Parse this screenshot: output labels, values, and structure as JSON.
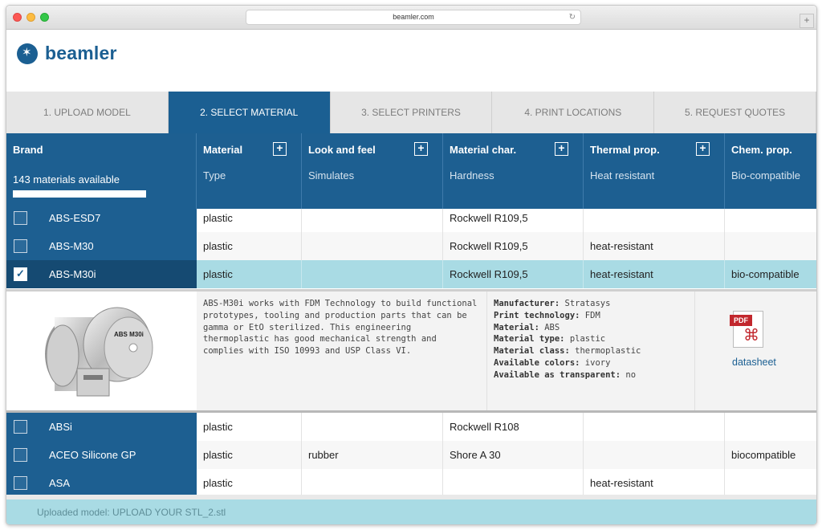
{
  "browser": {
    "url": "beamler.com"
  },
  "header": {
    "logo_text": "beamler"
  },
  "steps": [
    {
      "label": "1. UPLOAD MODEL"
    },
    {
      "label": "2. SELECT MATERIAL"
    },
    {
      "label": "3. SELECT PRINTERS"
    },
    {
      "label": "4. PRINT LOCATIONS"
    },
    {
      "label": "5. REQUEST QUOTES"
    }
  ],
  "columns": {
    "brand": {
      "title": "Brand",
      "count": "143 materials available"
    },
    "material": {
      "title": "Material",
      "sub": "Type"
    },
    "look": {
      "title": "Look and feel",
      "sub": "Simulates"
    },
    "char": {
      "title": "Material char.",
      "sub": "Hardness"
    },
    "thermal": {
      "title": "Thermal prop.",
      "sub": "Heat resistant"
    },
    "chem": {
      "title": "Chem. prop.",
      "sub": "Bio-compatible"
    }
  },
  "rows_top": [
    {
      "brand": "ABS-ESD7",
      "type": "plastic",
      "simulates": "",
      "hardness": "Rockwell R109,5",
      "heat": "",
      "bio": "",
      "checked": false
    },
    {
      "brand": "ABS-M30",
      "type": "plastic",
      "simulates": "",
      "hardness": "Rockwell R109,5",
      "heat": "heat-resistant",
      "bio": "",
      "checked": false
    },
    {
      "brand": "ABS-M30i",
      "type": "plastic",
      "simulates": "",
      "hardness": "Rockwell R109,5",
      "heat": "heat-resistant",
      "bio": "bio-compatible",
      "checked": true
    }
  ],
  "detail": {
    "description": "ABS-M30i works with FDM Technology to build functional prototypes, tooling and production parts that can be gamma or EtO sterilized. This engineering thermoplastic has good mechanical strength and complies with ISO 10993 and USP Class VI.",
    "specs": [
      {
        "label": "Manufacturer:",
        "value": "Stratasys"
      },
      {
        "label": "Print technology:",
        "value": "FDM"
      },
      {
        "label": "Material:",
        "value": "ABS"
      },
      {
        "label": "Material type:",
        "value": "plastic"
      },
      {
        "label": "Material class:",
        "value": "thermoplastic"
      },
      {
        "label": "Available colors:",
        "value": "ivory"
      },
      {
        "label": "Available as transparent:",
        "value": "no"
      }
    ],
    "pdf_tag": "PDF",
    "datasheet_label": "datasheet",
    "spool_label": "ABS M30i"
  },
  "rows_bottom": [
    {
      "brand": "ABSi",
      "type": "plastic",
      "simulates": "",
      "hardness": "Rockwell R108",
      "heat": "",
      "bio": "",
      "checked": false
    },
    {
      "brand": "ACEO Silicone GP",
      "type": "plastic",
      "simulates": "rubber",
      "hardness": "Shore A 30",
      "heat": "",
      "bio": "biocompatible",
      "checked": false
    },
    {
      "brand": "ASA",
      "type": "plastic",
      "simulates": "",
      "hardness": "",
      "heat": "heat-resistant",
      "bio": "",
      "checked": false
    }
  ],
  "footer": {
    "text": "Uploaded model: UPLOAD YOUR STL_2.stl"
  }
}
